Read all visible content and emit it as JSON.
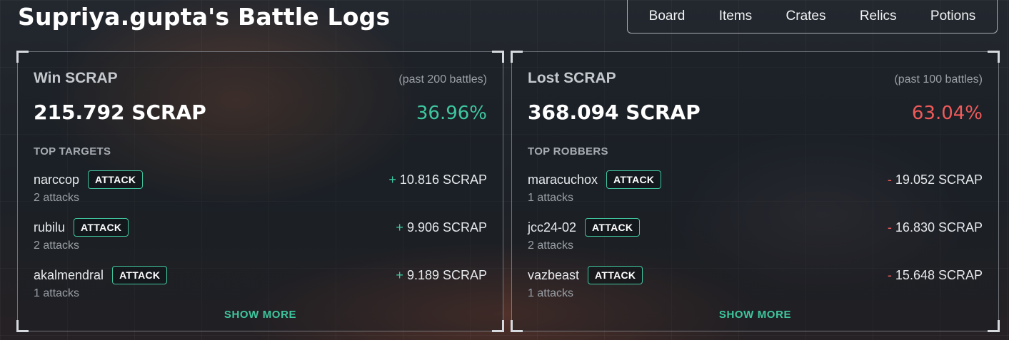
{
  "page": {
    "title": "Supriya.gupta's Battle Logs"
  },
  "nav": {
    "items": [
      "Board",
      "Items",
      "Crates",
      "Relics",
      "Potions"
    ]
  },
  "win": {
    "title": "Win SCRAP",
    "period": "(past 200 battles)",
    "total": "215.792 SCRAP",
    "percent": "36.96%",
    "section_label": "TOP TARGETS",
    "sign": "+",
    "rows": [
      {
        "name": "narccop",
        "button": "ATTACK",
        "amount": "10.816 SCRAP",
        "attacks": "2 attacks"
      },
      {
        "name": "rubilu",
        "button": "ATTACK",
        "amount": "9.906 SCRAP",
        "attacks": "2 attacks"
      },
      {
        "name": "akalmendral",
        "button": "ATTACK",
        "amount": "9.189 SCRAP",
        "attacks": "1 attacks"
      }
    ],
    "show_more": "SHOW MORE"
  },
  "lost": {
    "title": "Lost SCRAP",
    "period": "(past 100 battles)",
    "total": "368.094 SCRAP",
    "percent": "63.04%",
    "section_label": "TOP ROBBERS",
    "sign": "-",
    "rows": [
      {
        "name": "maracuchox",
        "button": "ATTACK",
        "amount": "19.052 SCRAP",
        "attacks": "1 attacks"
      },
      {
        "name": "jcc24-02",
        "button": "ATTACK",
        "amount": "16.830 SCRAP",
        "attacks": "2 attacks"
      },
      {
        "name": "vazbeast",
        "button": "ATTACK",
        "amount": "15.648 SCRAP",
        "attacks": "1 attacks"
      }
    ],
    "show_more": "SHOW MORE"
  },
  "colors": {
    "accent_green": "#3ec79f",
    "loss_red": "#f05a5a",
    "background": "#1f2329"
  }
}
